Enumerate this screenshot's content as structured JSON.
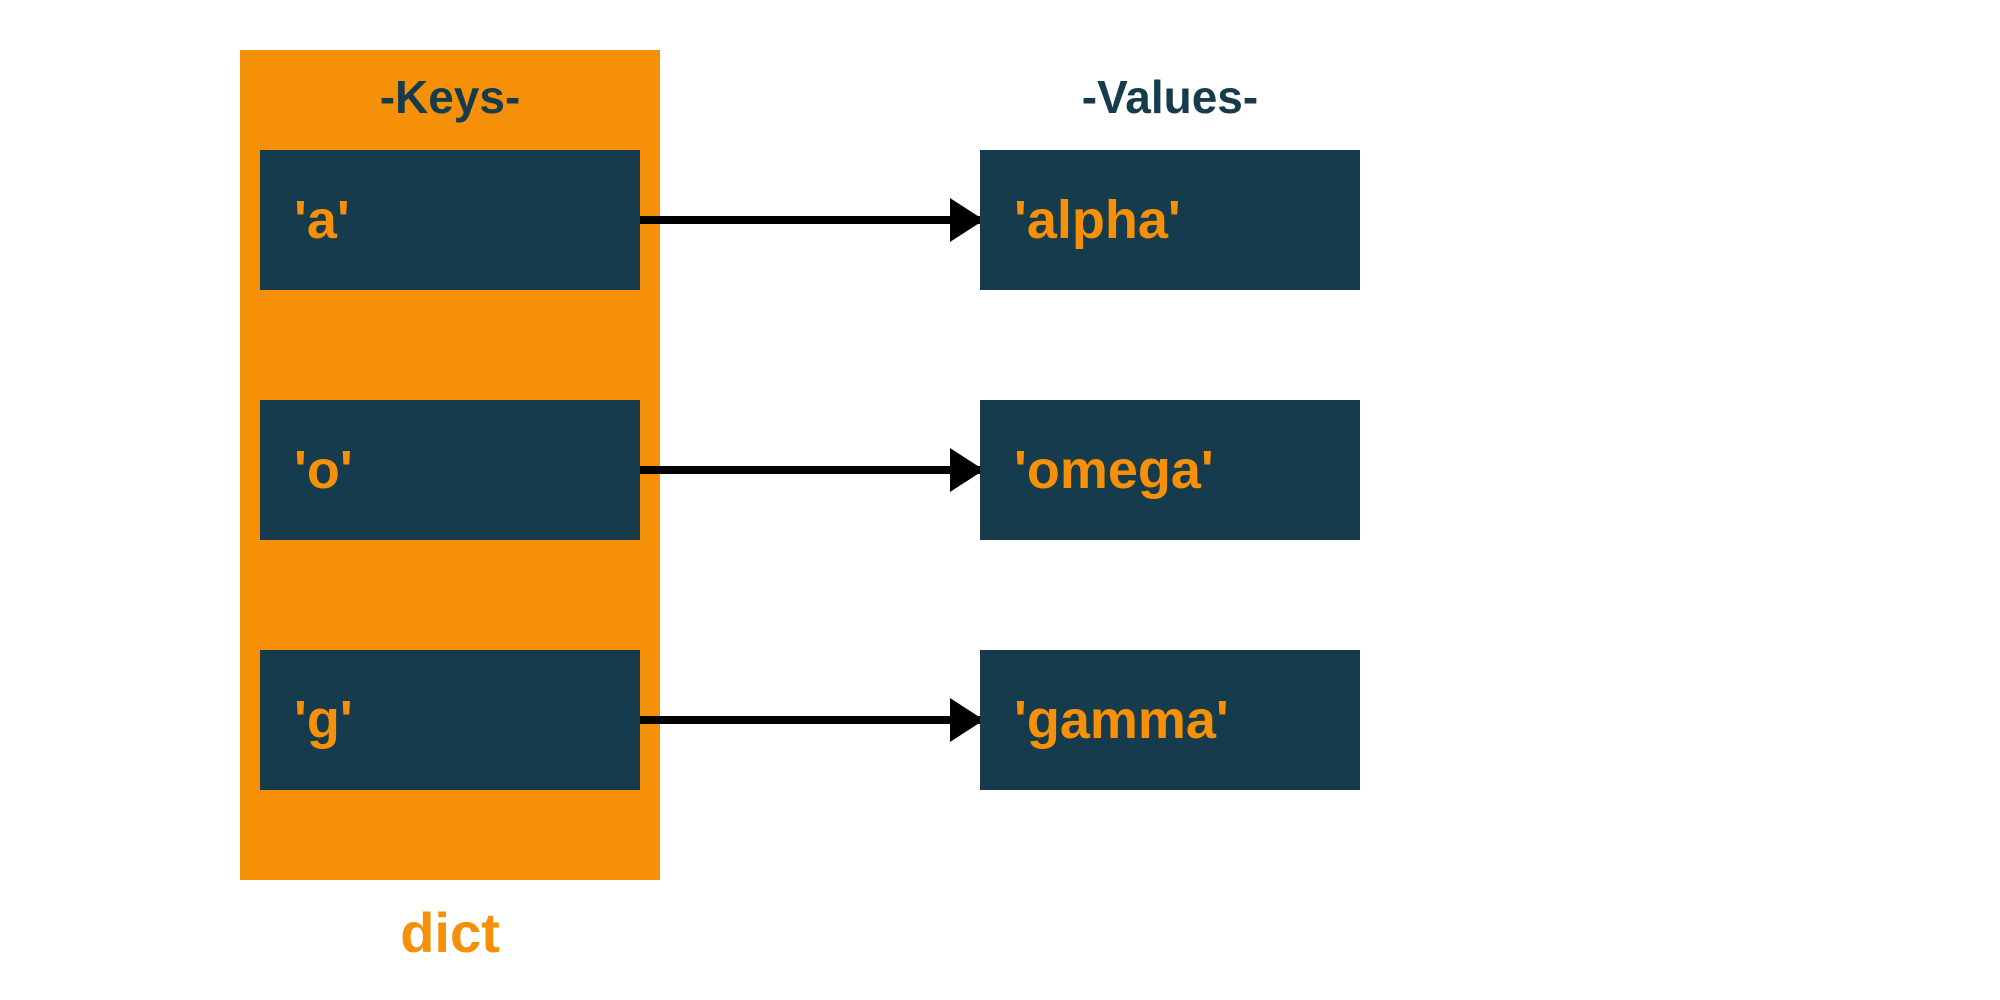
{
  "headers": {
    "keys": "-Keys-",
    "values": "-Values-"
  },
  "dict_label": "dict",
  "pairs": [
    {
      "key": "'a'",
      "value": "'alpha'"
    },
    {
      "key": "'o'",
      "value": "'omega'"
    },
    {
      "key": "'g'",
      "value": "'gamma'"
    }
  ],
  "colors": {
    "accent_orange": "#f69008",
    "cell_navy": "#163b4d",
    "arrow": "#000000",
    "background": "#ffffff"
  }
}
